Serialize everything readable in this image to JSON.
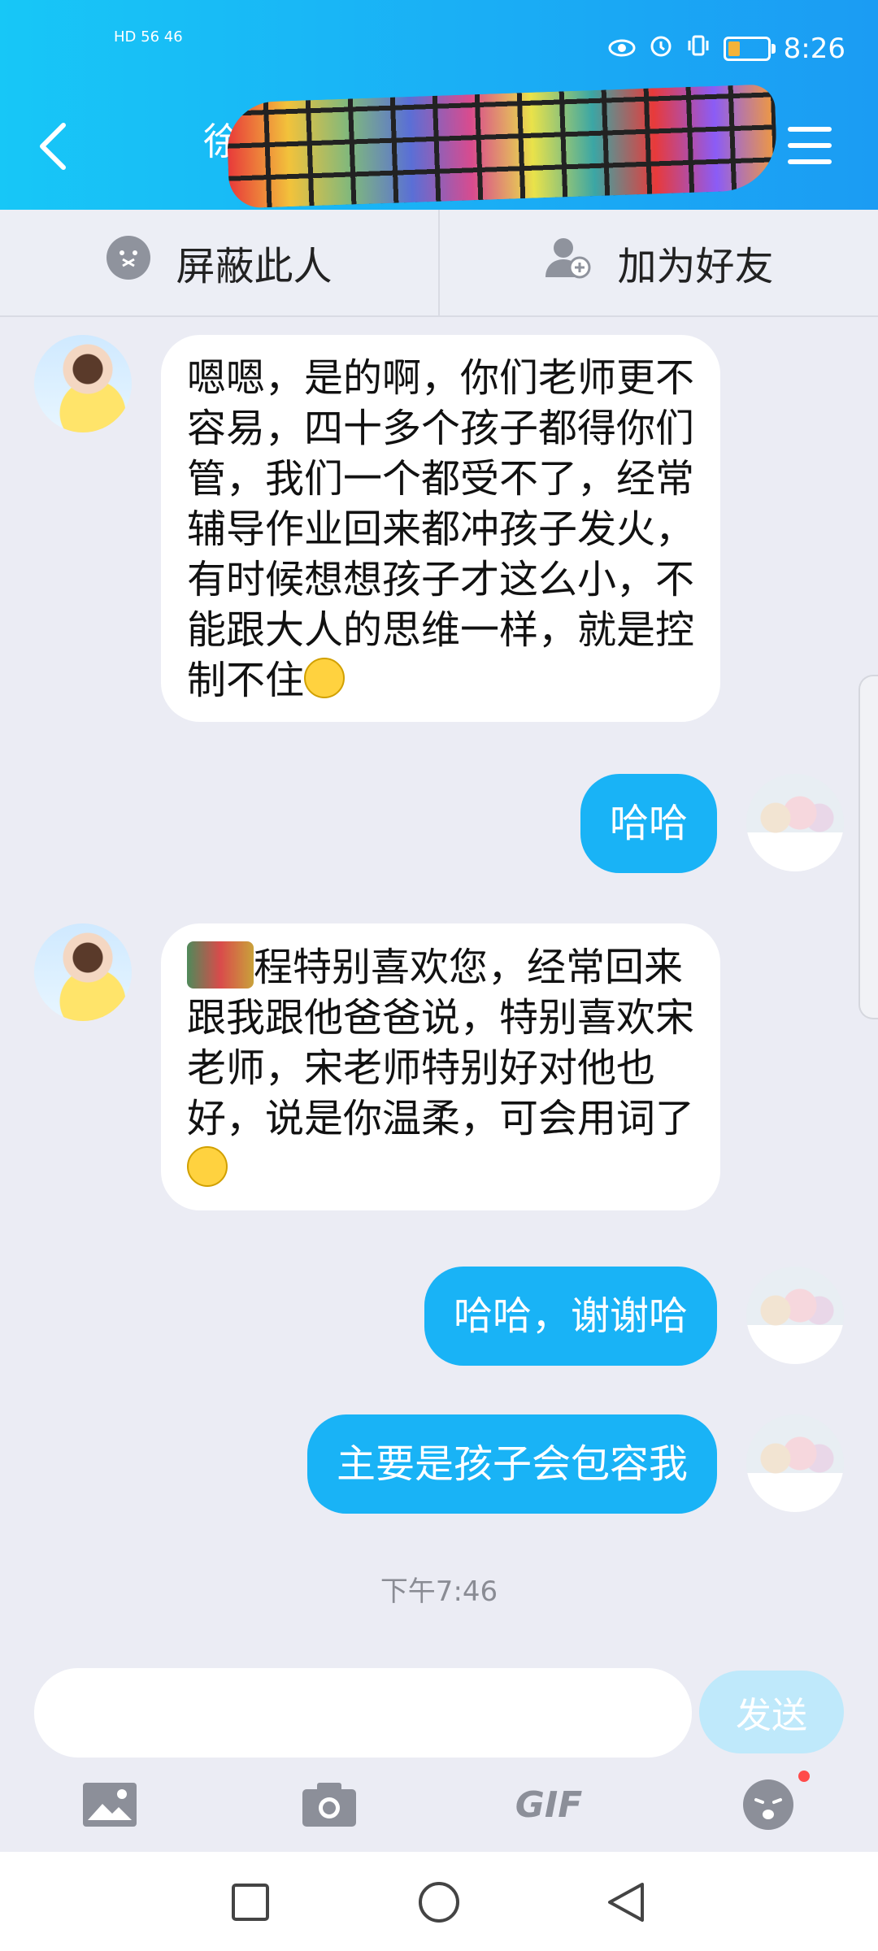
{
  "status_bar": {
    "network_left": "HD 56 46",
    "time": "8:26"
  },
  "header": {
    "title": "徐清",
    "menu_icon": "menu-icon",
    "back_icon": "back-icon"
  },
  "actions": {
    "block_label": "屏蔽此人",
    "add_friend_label": "加为好友"
  },
  "messages": [
    {
      "side": "in",
      "text": "嗯嗯，是的啊，你们老师更不容易，四十多个孩子都得你们管，我们一个都受不了，经常辅导作业回来都冲孩子发火，有时候想想孩子才这么小，不能跟大人的思维一样，就是控制不住"
    },
    {
      "side": "out",
      "text": "哈哈"
    },
    {
      "side": "in",
      "text": "程特别喜欢您，经常回来跟我跟他爸爸说，特别喜欢宋老师，宋老师特别好对他也好，说是你温柔，可会用词了"
    },
    {
      "side": "out",
      "text": "哈哈，谢谢哈"
    },
    {
      "side": "out",
      "text": "主要是孩子会包容我"
    }
  ],
  "timestamp": "下午7:46",
  "composer": {
    "placeholder": "",
    "send_label": "发送"
  },
  "toolbar": {
    "image_icon": "image-icon",
    "camera_icon": "camera-icon",
    "gif_label": "GIF",
    "emoji_icon": "emoji-icon"
  },
  "colors": {
    "header_blue": "#1aaef5",
    "bubble_out": "#19b3f6",
    "bubble_in": "#ffffff",
    "background": "#ebecf4",
    "send_disabled": "#bfe9fb"
  }
}
